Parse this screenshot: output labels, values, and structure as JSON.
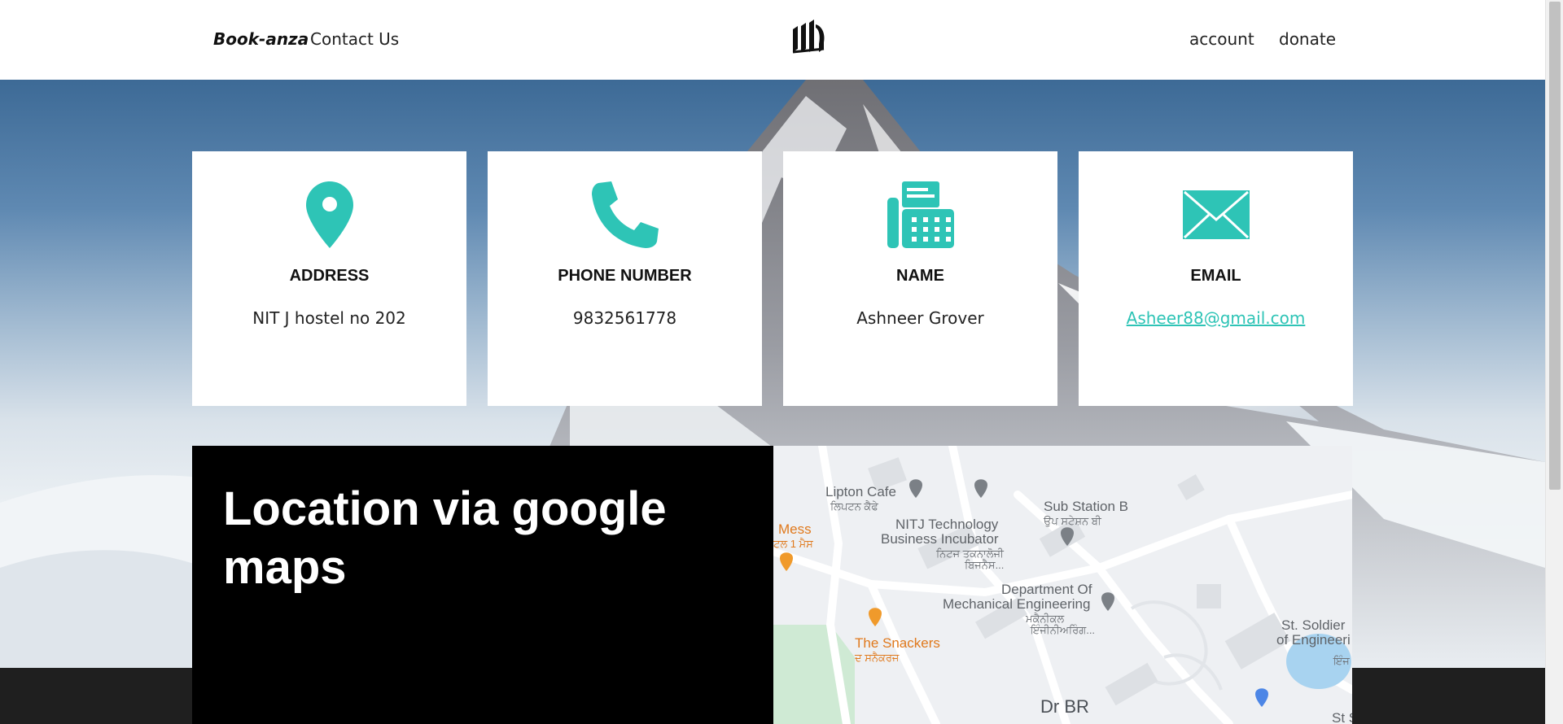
{
  "header": {
    "brand": "Book-anza",
    "nav_contact": "Contact Us",
    "logo_icon": "book-stack-logo-icon",
    "nav_account": "account",
    "nav_donate": "donate"
  },
  "colors": {
    "accent": "#2ec4b6",
    "panel": "#000000",
    "footer": "#1f1f1f"
  },
  "cards": [
    {
      "icon": "map-pin-icon",
      "title": "ADDRESS",
      "value": "NIT J hostel no 202"
    },
    {
      "icon": "phone-icon",
      "title": "PHONE NUMBER",
      "value": "9832561778"
    },
    {
      "icon": "fax-icon",
      "title": "NAME",
      "value": "Ashneer Grover"
    },
    {
      "icon": "envelope-icon",
      "title": "EMAIL",
      "value": "Asheer88@gmail.com"
    }
  ],
  "location": {
    "title": "Location via google maps"
  },
  "map": {
    "labels": {
      "lipton": "Lipton Cafe",
      "lipton_sub": "ਲਿਪਟਨ ਕੈਫੇ",
      "incubator_1": "NITJ Technology",
      "incubator_2": "Business Incubator",
      "incubator_sub_1": "ਨਿਟਜ ਤਕਨਾਲੋਜੀ",
      "incubator_sub_2": "ਬਿਜਨੈਸ...",
      "substation": "Sub Station B",
      "substation_sub": "ਉਪ ਸਟੇਸ਼ਨ ਬੀ",
      "mess": "Mess",
      "mess_sub": "ਟਲ 1 ਮੈਸ",
      "dept_1": "Department Of",
      "dept_2": "Mechanical Engineering",
      "dept_sub_1": "ਮਕੈਨੀਕਲ",
      "dept_sub_2": "ਇੰਜੀਨੀਅਰਿੰਗ...",
      "snackers": "The Snackers",
      "snackers_sub": "ਦ ਸਨੈਕਰਜ",
      "soldier_1": "St. Soldier",
      "soldier_2": "of Engineeri",
      "soldier_sub": "ਇੰਜ",
      "drbr": "Dr BR",
      "st_cut": "St S"
    }
  }
}
